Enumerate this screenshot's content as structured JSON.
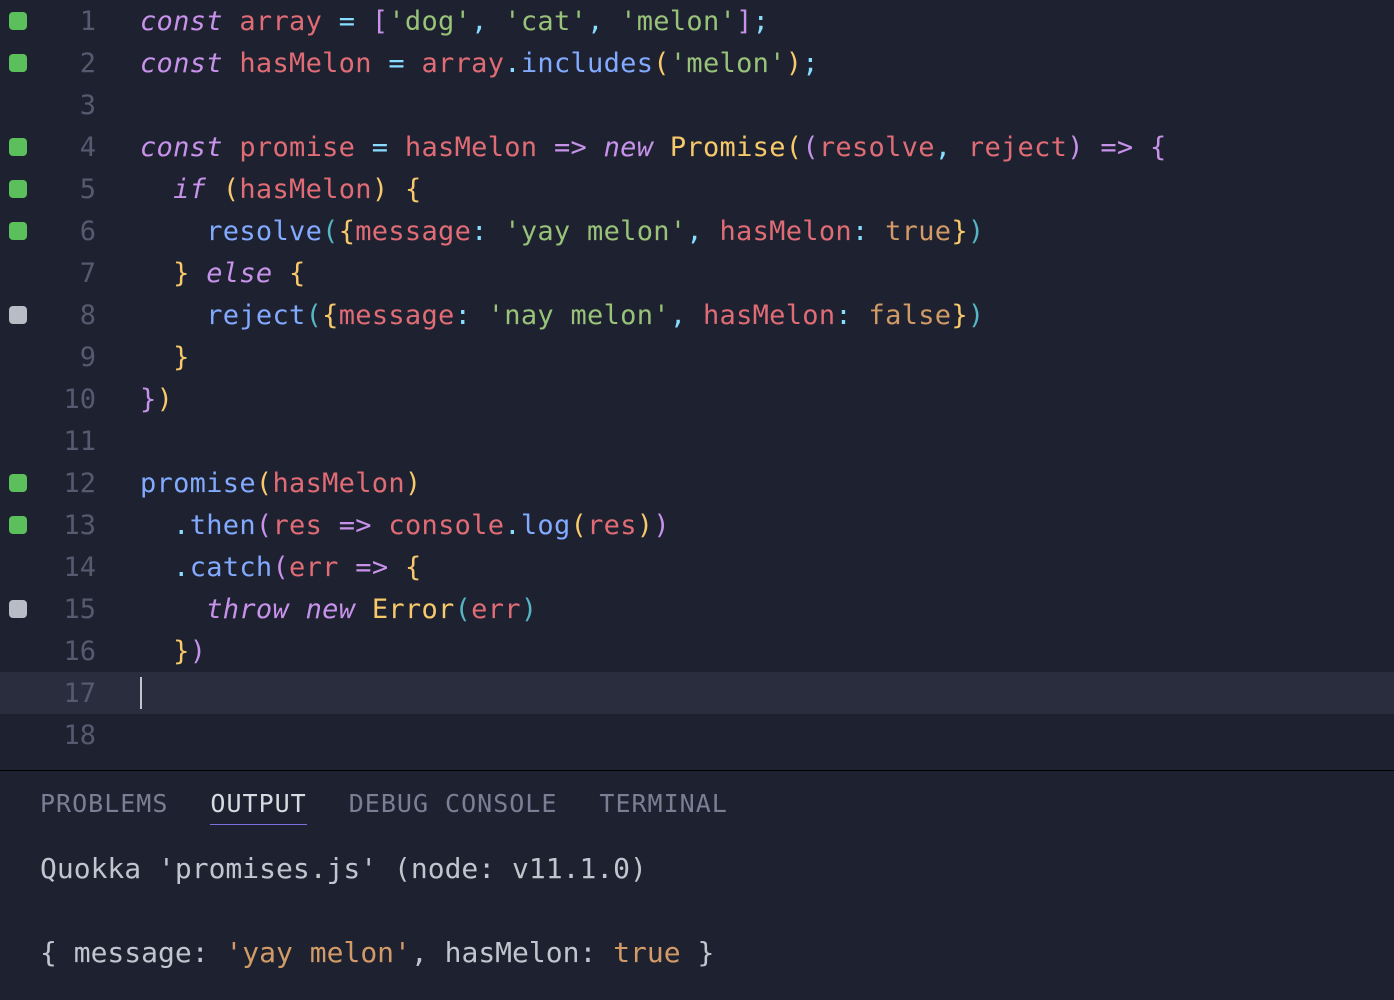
{
  "editor": {
    "total_lines": 18,
    "current_line": 17,
    "markers": {
      "1": "green",
      "2": "green",
      "4": "green",
      "5": "green",
      "6": "green",
      "8": "gray",
      "12": "green",
      "13": "green",
      "15": "gray"
    },
    "code": {
      "1": [
        [
          "kw",
          "const"
        ],
        [
          "co",
          " "
        ],
        [
          "var",
          "array"
        ],
        [
          "co",
          " "
        ],
        [
          "op",
          "="
        ],
        [
          "co",
          " "
        ],
        [
          "punc-p",
          "["
        ],
        [
          "str",
          "'dog'"
        ],
        [
          "op",
          ","
        ],
        [
          "co",
          " "
        ],
        [
          "str",
          "'cat'"
        ],
        [
          "op",
          ","
        ],
        [
          "co",
          " "
        ],
        [
          "str",
          "'melon'"
        ],
        [
          "punc-p",
          "]"
        ],
        [
          "op",
          ";"
        ]
      ],
      "2": [
        [
          "kw",
          "const"
        ],
        [
          "co",
          " "
        ],
        [
          "var",
          "hasMelon"
        ],
        [
          "co",
          " "
        ],
        [
          "op",
          "="
        ],
        [
          "co",
          " "
        ],
        [
          "var",
          "array"
        ],
        [
          "op",
          "."
        ],
        [
          "fn",
          "includes"
        ],
        [
          "punc-y",
          "("
        ],
        [
          "str",
          "'melon'"
        ],
        [
          "punc-y",
          ")"
        ],
        [
          "op",
          ";"
        ]
      ],
      "3": [],
      "4": [
        [
          "kw",
          "const"
        ],
        [
          "co",
          " "
        ],
        [
          "var",
          "promise"
        ],
        [
          "co",
          " "
        ],
        [
          "op",
          "="
        ],
        [
          "co",
          " "
        ],
        [
          "var",
          "hasMelon"
        ],
        [
          "co",
          " "
        ],
        [
          "arw",
          "=>"
        ],
        [
          "co",
          " "
        ],
        [
          "kw",
          "new"
        ],
        [
          "co",
          " "
        ],
        [
          "cls",
          "Promise"
        ],
        [
          "punc-y",
          "("
        ],
        [
          "punc-p",
          "("
        ],
        [
          "var",
          "resolve"
        ],
        [
          "op",
          ","
        ],
        [
          "co",
          " "
        ],
        [
          "var",
          "reject"
        ],
        [
          "punc-p",
          ")"
        ],
        [
          "co",
          " "
        ],
        [
          "arw",
          "=>"
        ],
        [
          "co",
          " "
        ],
        [
          "punc-p",
          "{"
        ]
      ],
      "5": [
        [
          "co",
          "  "
        ],
        [
          "kw",
          "if"
        ],
        [
          "co",
          " "
        ],
        [
          "punc-y",
          "("
        ],
        [
          "var",
          "hasMelon"
        ],
        [
          "punc-y",
          ")"
        ],
        [
          "co",
          " "
        ],
        [
          "punc-y",
          "{"
        ]
      ],
      "6": [
        [
          "co",
          "    "
        ],
        [
          "fn",
          "resolve"
        ],
        [
          "punc-b",
          "("
        ],
        [
          "punc-y",
          "{"
        ],
        [
          "prop",
          "message"
        ],
        [
          "op",
          ":"
        ],
        [
          "co",
          " "
        ],
        [
          "str",
          "'yay melon'"
        ],
        [
          "op",
          ","
        ],
        [
          "co",
          " "
        ],
        [
          "prop",
          "hasMelon"
        ],
        [
          "op",
          ":"
        ],
        [
          "co",
          " "
        ],
        [
          "bool",
          "true"
        ],
        [
          "punc-y",
          "}"
        ],
        [
          "punc-b",
          ")"
        ]
      ],
      "7": [
        [
          "co",
          "  "
        ],
        [
          "punc-y",
          "}"
        ],
        [
          "co",
          " "
        ],
        [
          "kw",
          "else"
        ],
        [
          "co",
          " "
        ],
        [
          "punc-y",
          "{"
        ]
      ],
      "8": [
        [
          "co",
          "    "
        ],
        [
          "fn",
          "reject"
        ],
        [
          "punc-b",
          "("
        ],
        [
          "punc-y",
          "{"
        ],
        [
          "prop",
          "message"
        ],
        [
          "op",
          ":"
        ],
        [
          "co",
          " "
        ],
        [
          "str",
          "'nay melon'"
        ],
        [
          "op",
          ","
        ],
        [
          "co",
          " "
        ],
        [
          "prop",
          "hasMelon"
        ],
        [
          "op",
          ":"
        ],
        [
          "co",
          " "
        ],
        [
          "bool",
          "false"
        ],
        [
          "punc-y",
          "}"
        ],
        [
          "punc-b",
          ")"
        ]
      ],
      "9": [
        [
          "co",
          "  "
        ],
        [
          "punc-y",
          "}"
        ]
      ],
      "10": [
        [
          "punc-p",
          "}"
        ],
        [
          "punc-y",
          ")"
        ]
      ],
      "11": [],
      "12": [
        [
          "fn",
          "promise"
        ],
        [
          "punc-y",
          "("
        ],
        [
          "var",
          "hasMelon"
        ],
        [
          "punc-y",
          ")"
        ]
      ],
      "13": [
        [
          "co",
          "  "
        ],
        [
          "op",
          "."
        ],
        [
          "fn",
          "then"
        ],
        [
          "punc-p",
          "("
        ],
        [
          "var",
          "res"
        ],
        [
          "co",
          " "
        ],
        [
          "arw",
          "=>"
        ],
        [
          "co",
          " "
        ],
        [
          "var",
          "console"
        ],
        [
          "op",
          "."
        ],
        [
          "fn",
          "log"
        ],
        [
          "punc-y",
          "("
        ],
        [
          "var",
          "res"
        ],
        [
          "punc-y",
          ")"
        ],
        [
          "punc-p",
          ")"
        ]
      ],
      "14": [
        [
          "co",
          "  "
        ],
        [
          "op",
          "."
        ],
        [
          "fn",
          "catch"
        ],
        [
          "punc-p",
          "("
        ],
        [
          "var",
          "err"
        ],
        [
          "co",
          " "
        ],
        [
          "arw",
          "=>"
        ],
        [
          "co",
          " "
        ],
        [
          "punc-y",
          "{"
        ]
      ],
      "15": [
        [
          "co",
          "    "
        ],
        [
          "kw",
          "throw"
        ],
        [
          "co",
          " "
        ],
        [
          "kw",
          "new"
        ],
        [
          "co",
          " "
        ],
        [
          "cls",
          "Error"
        ],
        [
          "punc-b",
          "("
        ],
        [
          "var",
          "err"
        ],
        [
          "punc-b",
          ")"
        ]
      ],
      "16": [
        [
          "co",
          "  "
        ],
        [
          "punc-y",
          "}"
        ],
        [
          "punc-p",
          ")"
        ]
      ],
      "17": [],
      "18": []
    }
  },
  "panel": {
    "tabs": [
      "PROBLEMS",
      "OUTPUT",
      "DEBUG CONSOLE",
      "TERMINAL"
    ],
    "active_tab": 1,
    "output_line1": "Quokka 'promises.js' (node: v11.1.0)",
    "output_line2_tokens": [
      [
        "bracket",
        "{ "
      ],
      [
        "k",
        "message"
      ],
      [
        "bracket",
        ": "
      ],
      [
        "s",
        "'yay melon'"
      ],
      [
        "bracket",
        ", "
      ],
      [
        "k",
        "hasMelon"
      ],
      [
        "bracket",
        ": "
      ],
      [
        "b",
        "true"
      ],
      [
        "bracket",
        " }"
      ]
    ]
  }
}
